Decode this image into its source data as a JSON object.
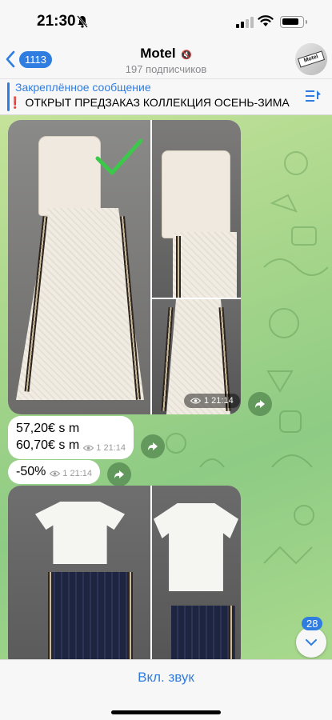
{
  "status_bar": {
    "time": "21:30",
    "icons": [
      "bell-slash-icon",
      "signal-icon",
      "wifi-icon",
      "battery-icon"
    ]
  },
  "header": {
    "back_badge": "1113",
    "channel_name": "Motel",
    "subscribers": "197 подписчиков",
    "avatar_text": "Motel"
  },
  "pinned": {
    "title": "Закреплённое сообщение",
    "text": "ОТКРЫТ ПРЕДЗАКАЗ КОЛЛЕКЦИЯ ОСЕНЬ-ЗИМА",
    "excl": "❗"
  },
  "messages": {
    "album1_time": "1 21:14",
    "price_line1": "57,20€ s m",
    "price_line2": "60,70€ s m",
    "price_time": "1 21:14",
    "discount": "-50%",
    "discount_time": "1 21:14"
  },
  "scroll": {
    "unread_count": "28"
  },
  "bottom": {
    "unmute_label": "Вкл. звук"
  },
  "colors": {
    "accent": "#2f7de1",
    "checkmark": "#3cc84a"
  }
}
